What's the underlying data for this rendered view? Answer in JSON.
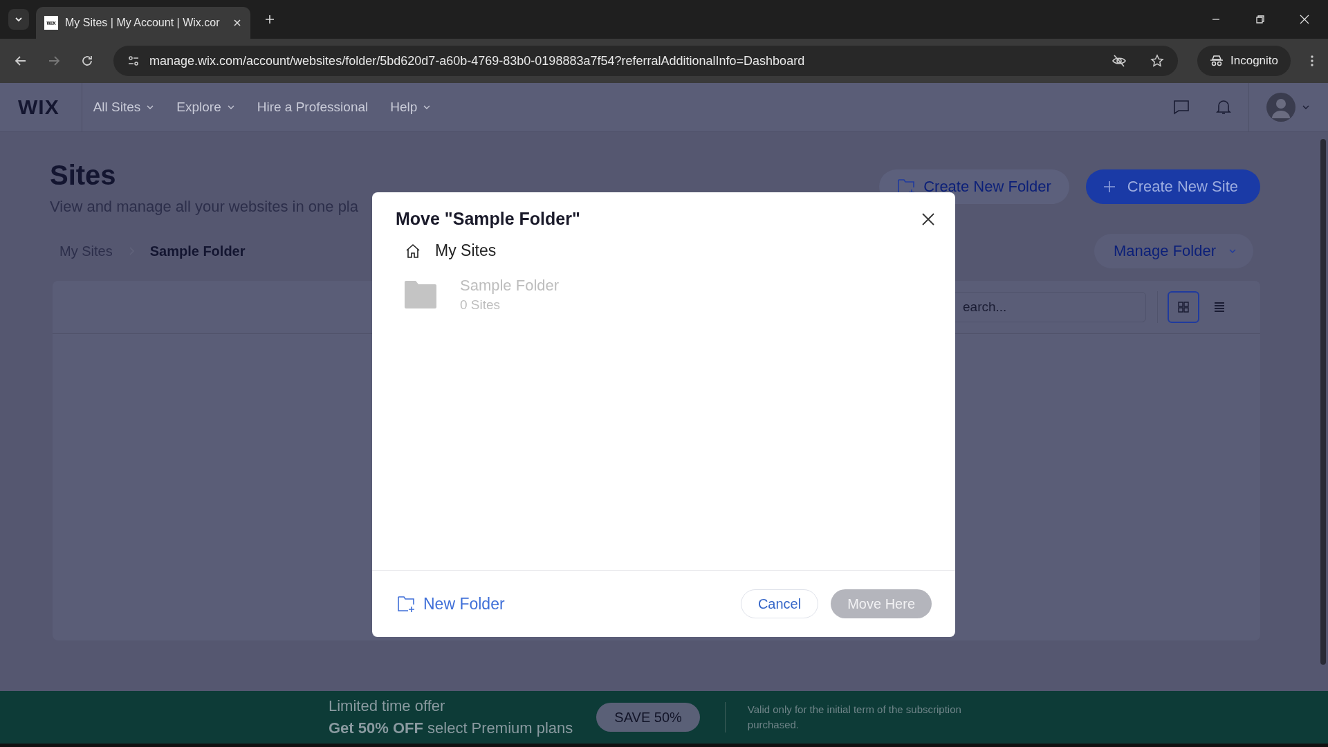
{
  "browser": {
    "tab_title": "My Sites | My Account | Wix.cor",
    "tab_favicon": "WIX",
    "url": "manage.wix.com/account/websites/folder/5bd620d7-a60b-4769-83b0-0198883a7f54?referralAdditionalInfo=Dashboard",
    "incognito_label": "Incognito"
  },
  "nav": {
    "logo": "WIX",
    "items": [
      {
        "label": "All Sites",
        "dropdown": true
      },
      {
        "label": "Explore",
        "dropdown": true
      },
      {
        "label": "Hire a Professional",
        "dropdown": false
      },
      {
        "label": "Help",
        "dropdown": true
      }
    ]
  },
  "page": {
    "title": "Sites",
    "subtitle": "View and manage all your websites in one pla",
    "create_folder_button": "Create New Folder",
    "create_site_button": "Create New Site",
    "breadcrumb": [
      {
        "label": "My Sites",
        "current": false
      },
      {
        "label": "Sample Folder",
        "current": true
      }
    ],
    "manage_folder_button": "Manage Folder",
    "search": {
      "placeholder": "earch..."
    },
    "views": [
      {
        "kind": "grid",
        "selected": true
      },
      {
        "kind": "list",
        "selected": false
      }
    ]
  },
  "modal": {
    "title": "Move \"Sample Folder\"",
    "root": "My Sites",
    "folders": [
      {
        "name": "Sample Folder",
        "count": "0 Sites",
        "disabled": true
      }
    ],
    "new_folder": "New Folder",
    "cancel": "Cancel",
    "confirm": {
      "label": "Move Here",
      "disabled": true
    }
  },
  "promo": {
    "line1": "Limited time offer",
    "line2": "**Get 50% OFF** select Premium plans",
    "button": "SAVE 50%",
    "note": "Valid only for the initial term of the subscription purchased."
  }
}
